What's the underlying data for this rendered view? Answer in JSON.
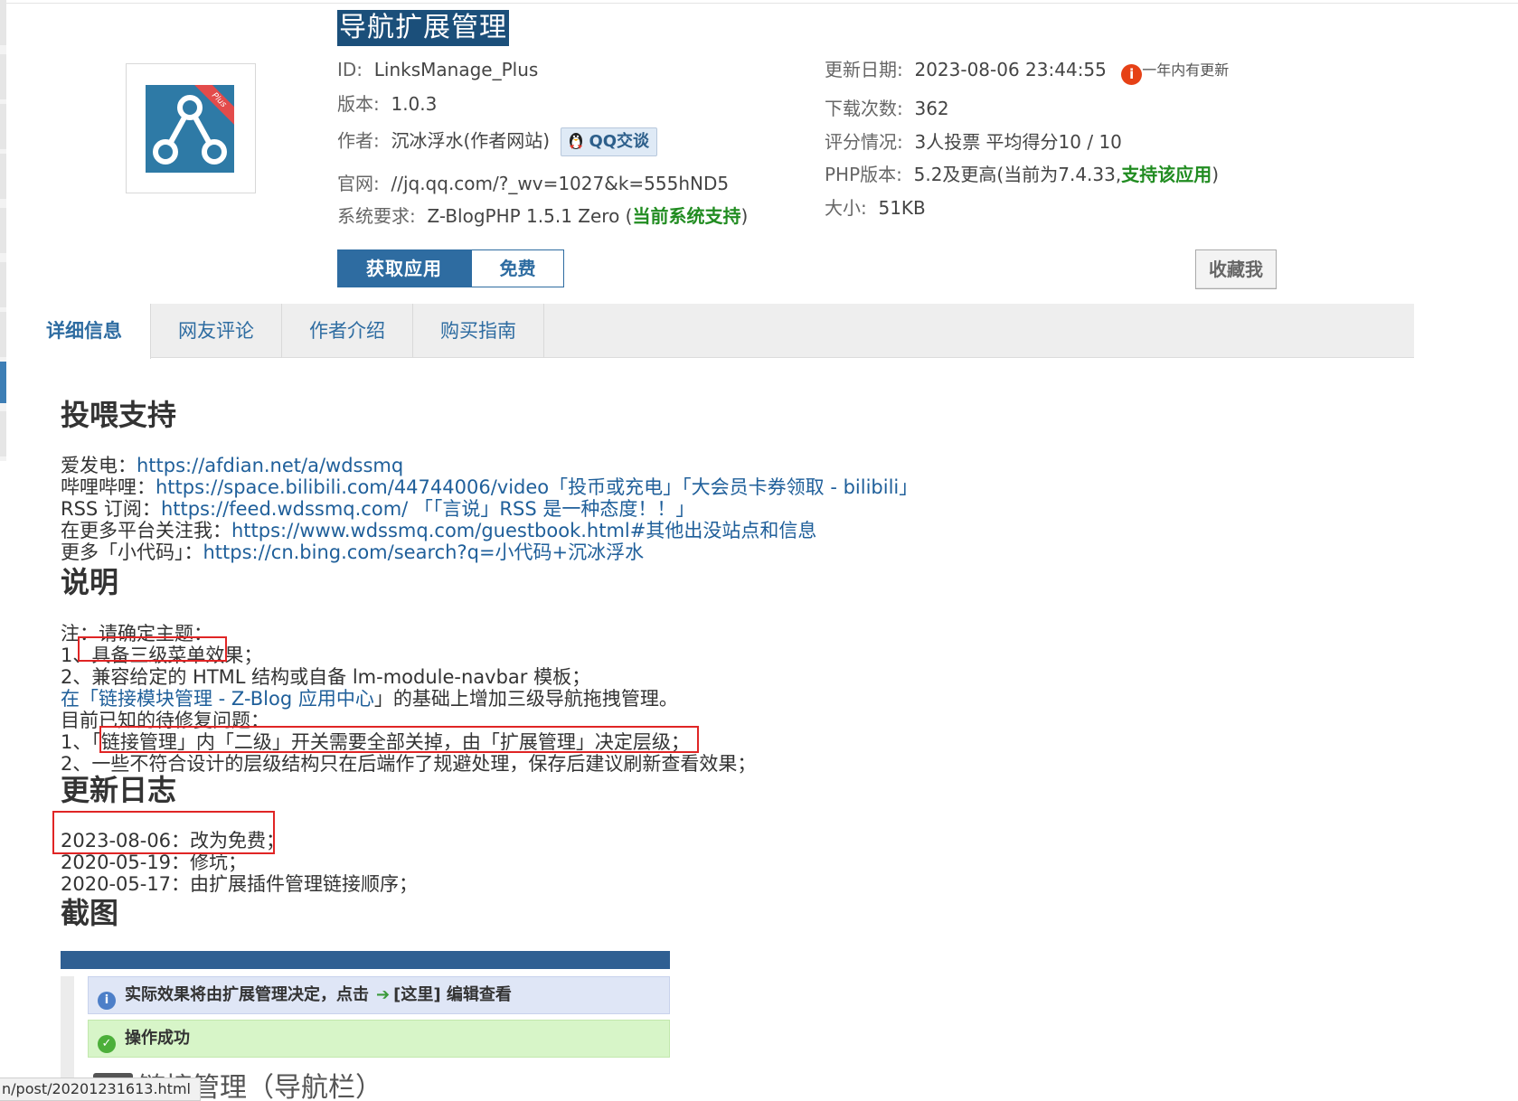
{
  "plugin": {
    "title": "导航扩展管理",
    "logo_badge": "Plus",
    "id_label": "ID:",
    "id_value": "LinksManage_Plus",
    "version_label": "版本:",
    "version_value": "1.0.3",
    "author_label": "作者:",
    "author_value": "沉冰浮水(作者网站)",
    "qq_label": "QQ交谈",
    "site_label": "官网:",
    "site_value": "//jq.qq.com/?_wv=1027&k=555hND5",
    "req_label": "系统要求:",
    "req_value": "Z-BlogPHP 1.5.1 Zero (",
    "req_support": "当前系统支持",
    "req_close": ")",
    "update_label": "更新日期:",
    "update_value": "2023-08-06 23:44:55",
    "update_note": "一年内有更新",
    "downloads_label": "下载次数:",
    "downloads_value": "362",
    "rating_label": "评分情况:",
    "rating_value": "3人投票 平均得分10 / 10",
    "php_label": "PHP版本:",
    "php_value": "5.2及更高(当前为7.4.33,",
    "php_support": "支持该应用",
    "php_close": ")",
    "size_label": "大小:",
    "size_value": "51KB"
  },
  "actions": {
    "get_label": "获取应用",
    "price_label": "免费",
    "favorite_label": "收藏我"
  },
  "tabs": [
    {
      "label": "详细信息"
    },
    {
      "label": "网友评论"
    },
    {
      "label": "作者介绍"
    },
    {
      "label": "购买指南"
    }
  ],
  "content": {
    "support_heading": "投喂支持",
    "support_lines": [
      {
        "prefix": "爱发电：",
        "link": "https://afdian.net/a/wdssmq",
        "suffix": ""
      },
      {
        "prefix": "哔哩哔哩：",
        "link": "https://space.bilibili.com/44744006/video「投币或充电」「大会员卡券领取 - bilibili」",
        "suffix": ""
      },
      {
        "prefix": "RSS 订阅：",
        "link": "https://feed.wdssmq.com/ 「「言说」RSS 是一种态度！！」",
        "suffix": ""
      },
      {
        "prefix": "在更多平台关注我：",
        "link": "https://www.wdssmq.com/guestbook.html#其他出没站点和信息",
        "suffix": ""
      },
      {
        "prefix": "更多「小代码」：",
        "link": "https://cn.bing.com/search?q=小代码+沉冰浮水",
        "suffix": ""
      }
    ],
    "desc_heading": "说明",
    "desc_lines": [
      {
        "prefix": "注：请确定主题：",
        "link": "",
        "suffix": ""
      },
      {
        "prefix": "1、具备三级菜单效果；",
        "link": "",
        "suffix": ""
      },
      {
        "prefix": "2、兼容给定的 HTML 结构或自备 lm-module-navbar 模板；",
        "link": "",
        "suffix": ""
      },
      {
        "prefix": "在「",
        "link": "链接模块管理 - Z-Blog 应用中心",
        "suffix": "」的基础上增加三级导航拖拽管理。"
      },
      {
        "prefix": "目前已知的待修复问题：",
        "link": "",
        "suffix": ""
      },
      {
        "prefix": "1、「链接管理」内「二级」开关需要全部关掉，由「扩展管理」决定层级；",
        "link": "",
        "suffix": ""
      },
      {
        "prefix": "2、一些不符合设计的层级结构只在后端作了规避处理，保存后建议刷新查看效果；",
        "link": "",
        "suffix": ""
      }
    ],
    "log_heading": "更新日志",
    "log_lines": [
      {
        "prefix": "2023-08-06：改为免费；",
        "link": "",
        "suffix": ""
      },
      {
        "prefix": "2020-05-19：修坑；",
        "link": "",
        "suffix": ""
      },
      {
        "prefix": "2020-05-17：由扩展插件管理链接顺序；",
        "link": "",
        "suffix": ""
      }
    ],
    "shot_heading": "截图"
  },
  "screenshot": {
    "info_text": "实际效果将由扩展管理决定，点击",
    "info_link": "[这里]",
    "info_after": " 编辑查看",
    "ok_text": "操作成功",
    "heading_text": "链接管理（导航栏）"
  },
  "status_bar": {
    "url": "n/post/20201231613.html"
  },
  "colors": {
    "brand_blue": "#2e6ca1",
    "title_bg": "#1b4f7a",
    "support_green": "#218c21",
    "highlight_red": "#e02525"
  }
}
